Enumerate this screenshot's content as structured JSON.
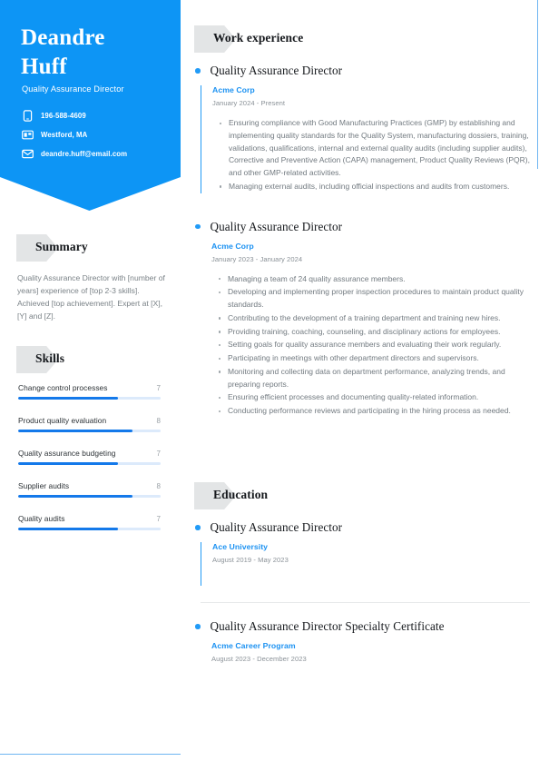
{
  "colors": {
    "brand_blue": "#0d95f5",
    "accent_blue": "#219bf7",
    "link_blue": "#1c92f2",
    "skill_fill": "#1479ea",
    "skill_track": "#dceafb",
    "tag_gray": "#e3e5e6",
    "body_gray": "#727a80"
  },
  "header": {
    "name": "Deandre Huff",
    "name_line1": "Deandre",
    "name_line2": "Huff",
    "job_title": "Quality Assurance Director",
    "contacts": [
      {
        "icon": "phone-icon",
        "text": "196-588-4609"
      },
      {
        "icon": "location-icon",
        "text": "Westford, MA"
      },
      {
        "icon": "email-icon",
        "text": "deandre.huff@email.com"
      }
    ]
  },
  "summary": {
    "heading": "Summary",
    "text": "Quality Assurance Director with [number of years] experience of [top 2-3 skills]. Achieved [top achievement]. Expert at [X], [Y] and [Z]."
  },
  "skills": {
    "heading": "Skills",
    "items": [
      {
        "name": "Change control processes",
        "score": "7",
        "percent": 70
      },
      {
        "name": "Product quality evaluation",
        "score": "8",
        "percent": 80
      },
      {
        "name": "Quality assurance budgeting",
        "score": "7",
        "percent": 70
      },
      {
        "name": "Supplier audits",
        "score": "8",
        "percent": 80
      },
      {
        "name": "Quality audits",
        "score": "7",
        "percent": 70
      }
    ]
  },
  "work": {
    "heading": "Work experience",
    "entries": [
      {
        "title": "Quality Assurance Director",
        "org": "Acme Corp",
        "dates": "January 2024 - Present",
        "bullets": [
          "Ensuring compliance with Good Manufacturing Practices (GMP) by establishing and implementing quality standards for the Quality System, manufacturing dossiers, training, validations, qualifications, internal and external quality audits (including supplier audits), Corrective and Preventive Action (CAPA) management, Product Quality Reviews (PQR), and other GMP-related activities.",
          "Managing external audits, including official inspections and audits from customers."
        ]
      },
      {
        "title": "Quality Assurance Director",
        "org": "Acme Corp",
        "dates": "January 2023 - January 2024",
        "bullets": [
          "Managing a team of 24 quality assurance members.",
          "Developing and implementing proper inspection procedures to maintain product quality standards.",
          "Contributing to the development of a training department and training new hires.",
          "Providing training, coaching, counseling, and disciplinary actions for employees.",
          "Setting goals for quality assurance members and evaluating their work regularly.",
          "Participating in meetings with other department directors and supervisors.",
          "Monitoring and collecting data on department performance, analyzing trends, and preparing reports.",
          "Ensuring efficient processes and documenting quality-related information.",
          "Conducting performance reviews and participating in the hiring process as needed."
        ]
      }
    ]
  },
  "education": {
    "heading": "Education",
    "entries": [
      {
        "title": "Quality Assurance Director",
        "org": "Ace University",
        "dates": "August 2019 - May 2023"
      },
      {
        "title": "Quality Assurance Director Specialty Certificate",
        "org": "Acme Career Program",
        "dates": "August 2023 - December 2023"
      }
    ]
  }
}
